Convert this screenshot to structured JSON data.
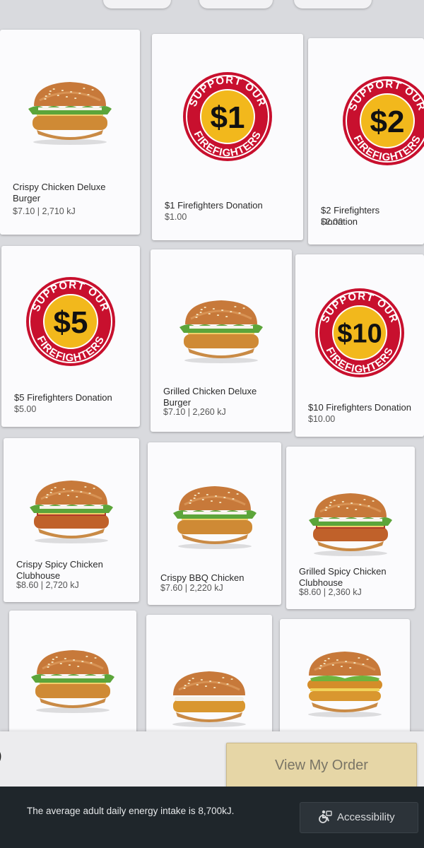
{
  "menu": {
    "items": [
      {
        "name": "Crispy Chicken Deluxe Burger",
        "price": "$7.10 | 2,710 kJ",
        "kind": "burger",
        "variant": "deluxe-crispy"
      },
      {
        "name": "$1 Firefighters Donation",
        "price": "$1.00",
        "kind": "donation",
        "amount": "$1"
      },
      {
        "name": "$2 Firefighters Donation",
        "price": "$2.00",
        "kind": "donation",
        "amount": "$2"
      },
      {
        "name": "$5 Firefighters Donation",
        "price": "$5.00",
        "kind": "donation",
        "amount": "$5"
      },
      {
        "name": "Grilled Chicken Deluxe Burger",
        "price": "$7.10 | 2,260 kJ",
        "kind": "burger",
        "variant": "deluxe-grilled"
      },
      {
        "name": "$10 Firefighters Donation",
        "price": "$10.00",
        "kind": "donation",
        "amount": "$10"
      },
      {
        "name": "Crispy Spicy Chicken Clubhouse",
        "price": "$8.60 | 2,720 kJ",
        "kind": "burger",
        "variant": "clubhouse"
      },
      {
        "name": "Crispy BBQ Chicken",
        "price": "$7.60 | 2,220 kJ",
        "kind": "burger",
        "variant": "bbq"
      },
      {
        "name": "Grilled Spicy Chicken Clubhouse",
        "price": "$8.60 | 2,360 kJ",
        "kind": "burger",
        "variant": "clubhouse"
      },
      {
        "name": "",
        "price": "",
        "kind": "burger",
        "variant": "bbq-grilled"
      },
      {
        "name": "",
        "price": "",
        "kind": "burger",
        "variant": "plain"
      },
      {
        "name": "",
        "price": "",
        "kind": "burger",
        "variant": "double"
      }
    ],
    "badge_top_text": "SUPPORT OUR",
    "badge_bottom_text": "FIREFIGHTERS"
  },
  "order": {
    "view_label": "View My Order"
  },
  "left_glyph": ")",
  "footer": {
    "energy_text": "The average adult daily energy intake is 8,700kJ.",
    "accessibility_label": "Accessibility",
    "accessibility_icon": "wheelchair-icon"
  },
  "colors": {
    "badge_red": "#c8102e",
    "badge_yellow": "#f2b81c",
    "order_button": "#e6d6a6",
    "footer_bg": "#1f262b"
  }
}
